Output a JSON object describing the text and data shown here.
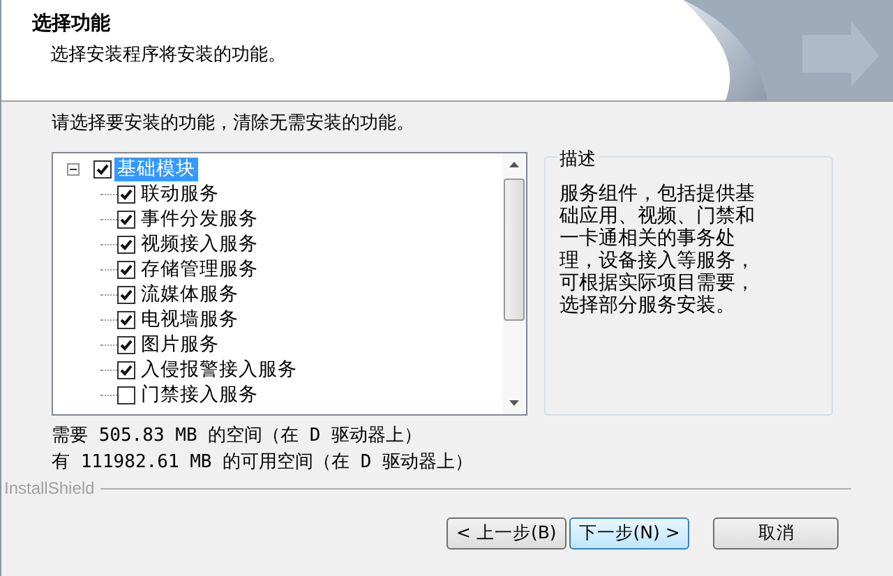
{
  "header": {
    "title": "选择功能",
    "subtitle": "选择安装程序将安装的功能。"
  },
  "instruction": "请选择要安装的功能，清除无需安装的功能。",
  "tree": {
    "items": [
      {
        "label": "基础模块",
        "checked": true,
        "expanded": true,
        "selected": true,
        "children": [
          {
            "label": "联动服务",
            "checked": true,
            "selected": false
          },
          {
            "label": "事件分发服务",
            "checked": true,
            "selected": false
          },
          {
            "label": "视频接入服务",
            "checked": true,
            "selected": false
          },
          {
            "label": "存储管理服务",
            "checked": true,
            "selected": false
          },
          {
            "label": "流媒体服务",
            "checked": true,
            "selected": false
          },
          {
            "label": "电视墙服务",
            "checked": true,
            "selected": false
          },
          {
            "label": "图片服务",
            "checked": true,
            "selected": false
          },
          {
            "label": "入侵报警接入服务",
            "checked": true,
            "selected": false
          },
          {
            "label": "门禁接入服务",
            "checked": false,
            "selected": false
          }
        ]
      }
    ]
  },
  "description": {
    "title": "描述",
    "text": "服务组件，包括提供基础应用、视频、门禁和一卡通相关的事务处理，设备接入等服务，可根据实际项目需要，选择部分服务安装。"
  },
  "space": [
    "需要 505.83 MB 的空间（在 D 驱动器上）",
    "有 111982.61 MB 的可用空间（在 D 驱动器上）"
  ],
  "brand": "InstallShield",
  "buttons": [
    {
      "label": "< 上一步(B)",
      "kind": "normal"
    },
    {
      "label": "下一步(N) >",
      "kind": "default"
    },
    {
      "label": "取消",
      "kind": "cancel"
    }
  ]
}
